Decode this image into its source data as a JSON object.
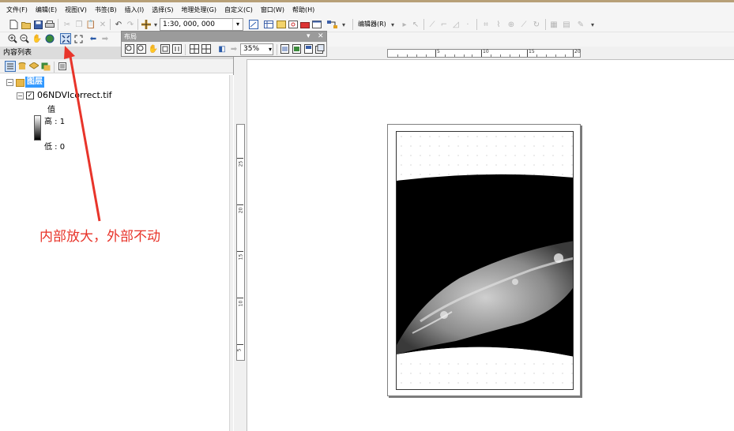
{
  "menu": {
    "items": [
      "文件(F)",
      "编辑(E)",
      "视图(V)",
      "书签(B)",
      "插入(I)",
      "选择(S)",
      "地理处理(G)",
      "自定义(C)",
      "窗口(W)",
      "帮助(H)"
    ]
  },
  "toolbar": {
    "scale": "1:30, 000, 000",
    "editor_label": "编辑器(R)"
  },
  "layout_toolbar": {
    "title": "布局",
    "zoom": "35%"
  },
  "toc": {
    "title": "内容列表",
    "group_label": "图层",
    "layer_name": "06NDVIcorrect.tif",
    "legend_title": "值",
    "legend_high": "高 : 1",
    "legend_low": "低 : 0"
  },
  "ruler": {
    "top_labels": [
      "5",
      "10",
      "15",
      "20"
    ],
    "left_labels": [
      "25",
      "20",
      "15",
      "10",
      "5"
    ]
  },
  "annotation": {
    "text": "内部放大，外部不动",
    "color": "#e8342a"
  },
  "icons": [
    "new-document-icon",
    "open-icon",
    "save-icon",
    "print-icon",
    "cut-icon",
    "copy-icon",
    "paste-icon",
    "delete-icon",
    "undo-icon",
    "redo-icon",
    "add-data-icon",
    "zoom-in-icon",
    "zoom-out-icon",
    "pan-icon",
    "full-extent-icon",
    "fixed-zoom-in-icon",
    "fixed-zoom-out-icon",
    "back-icon",
    "forward-icon",
    "layers-icon",
    "checkbox-icon"
  ]
}
